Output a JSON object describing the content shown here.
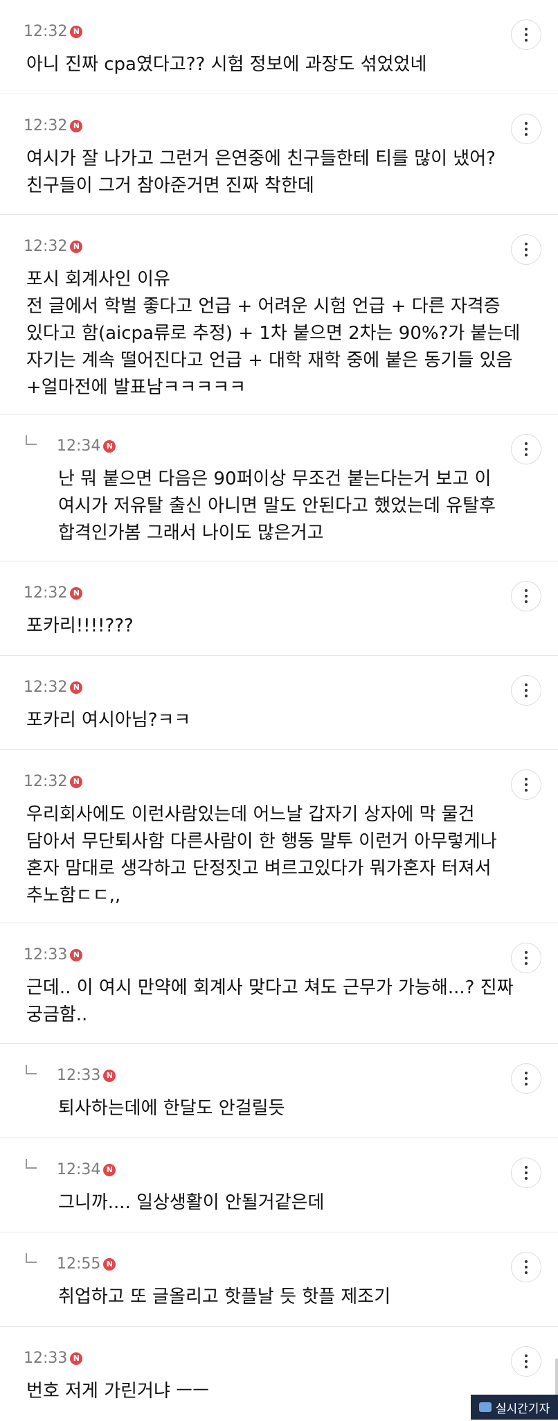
{
  "badge_label": "N",
  "comments": [
    {
      "time": "12:32",
      "text": "아니 진짜 cpa였다고?? 시험 정보에 과장도 섞었었네"
    },
    {
      "time": "12:32",
      "text": "여시가 잘 나가고 그런거 은연중에 친구들한테 티를 많이 냈어?\n친구들이 그거 참아준거면 진짜 착한데"
    },
    {
      "time": "12:32",
      "text": "포시 회계사인 이유\n전 글에서 학벌 좋다고 언급 + 어려운 시험 언급 + 다른 자격증\n있다고 함(aicpa류로 추정) + 1차 붙으면 2차는 90%?가 붙는데\n자기는 계속 떨어진다고 언급 + 대학 재학 중에 붙은 동기들 있음\n+얼마전에 발표남ㅋㅋㅋㅋㅋ"
    },
    {
      "time": "12:34",
      "text": "난 뭐 붙으면 다음은 90퍼이상 무조건 붙는다는거 보고 이\n여시가 저유탈 출신 아니면 말도 안된다고 했었는데 유탈후\n합격인가봄 그래서 나이도 많은거고"
    },
    {
      "time": "12:32",
      "text": "포카리!!!!???"
    },
    {
      "time": "12:32",
      "text": "포카리 여시아님?ㅋㅋ"
    },
    {
      "time": "12:32",
      "text": "우리회사에도 이런사람있는데 어느날 갑자기 상자에 막 물건\n담아서 무단퇴사함 다른사람이 한 행동 말투 이런거 아무렇게나\n혼자 맘대로 생각하고 단정짓고 벼르고있다가 뭐가혼자 터져서\n추노함ㄷㄷ,,"
    },
    {
      "time": "12:33",
      "text": "근데.. 이 여시 만약에 회계사 맞다고 쳐도 근무가 가능해...? 진짜\n궁금함.."
    },
    {
      "time": "12:33",
      "text": "퇴사하는데에 한달도 안걸릴듯"
    },
    {
      "time": "12:34",
      "text": "그니까.... 일상생활이 안될거같은데"
    },
    {
      "time": "12:55",
      "text": "취업하고 또 글올리고 핫플날 듯 핫플 제조기"
    },
    {
      "time": "12:33",
      "text": "번호 저게 가린거냐 ㅡㅡ"
    }
  ],
  "watermark": "실시간기자"
}
